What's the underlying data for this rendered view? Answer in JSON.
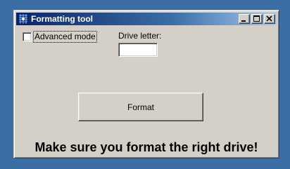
{
  "window": {
    "title": "Formatting tool",
    "icon": "app-grid-icon",
    "controls": {
      "minimize": "minimize-icon",
      "maximize": "maximize-icon",
      "close": "close-icon"
    }
  },
  "form": {
    "advanced_mode": {
      "label": "Advanced mode",
      "checked": false
    },
    "drive_letter": {
      "label": "Drive letter:",
      "value": ""
    },
    "format_button_label": "Format"
  },
  "warning_text": "Make sure you format the right drive!",
  "colors": {
    "desktop": "#3a6ea5",
    "window_face": "#d4d0c8",
    "title_active_start": "#0a246a",
    "title_active_end": "#a6caf0"
  }
}
